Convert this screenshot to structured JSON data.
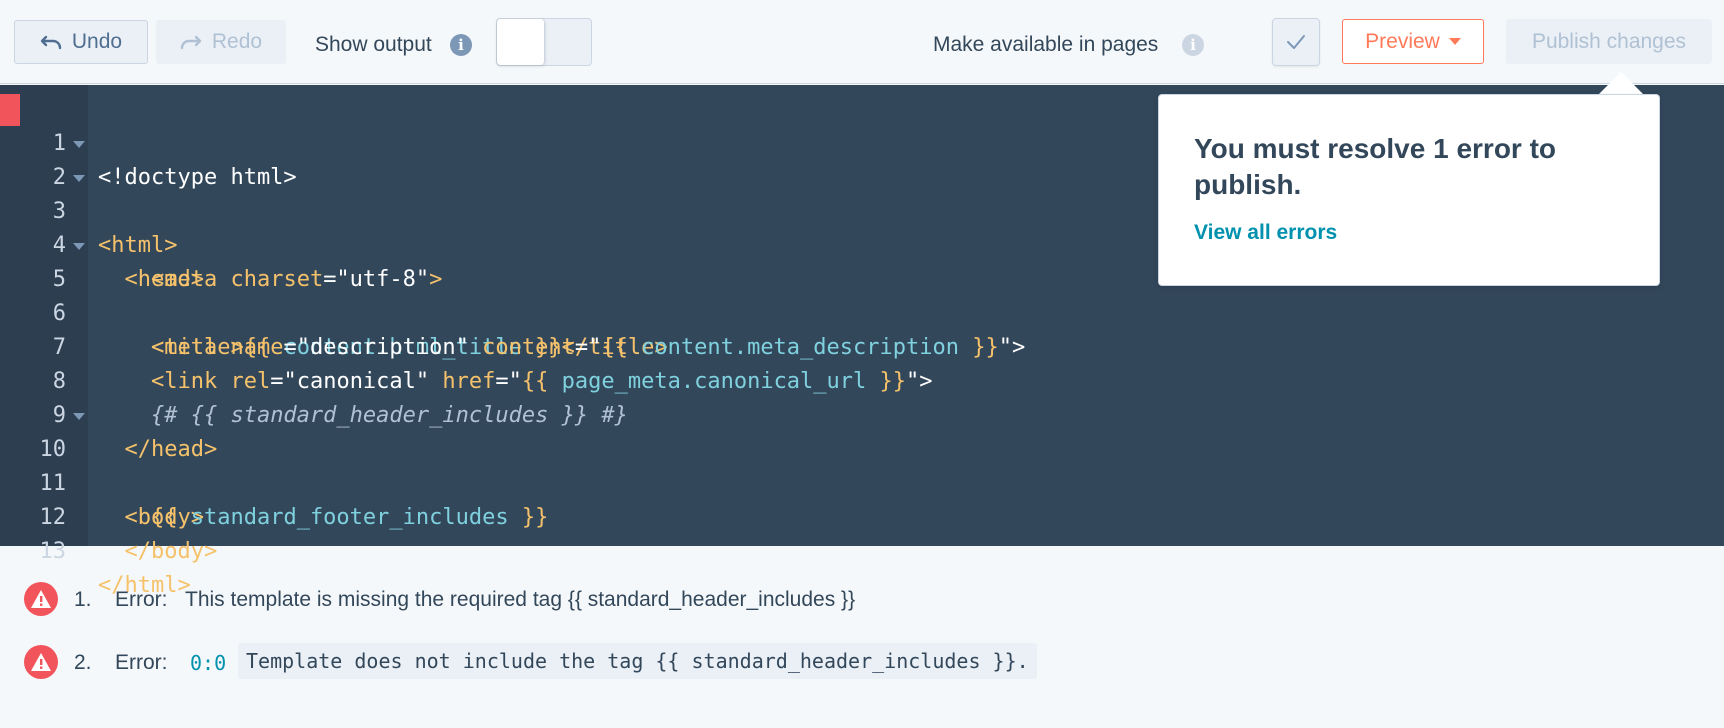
{
  "toolbar": {
    "undo_label": "Undo",
    "redo_label": "Redo",
    "show_output_label": "Show output",
    "make_available_label": "Make available in pages",
    "preview_label": "Preview",
    "publish_label": "Publish changes"
  },
  "editor": {
    "lines": [
      {
        "n": "1",
        "fold": false
      },
      {
        "n": "2",
        "fold": true
      },
      {
        "n": "3",
        "fold": true
      },
      {
        "n": "4",
        "fold": false
      },
      {
        "n": "5",
        "fold": true
      },
      {
        "n": "6",
        "fold": false
      },
      {
        "n": "7",
        "fold": false
      },
      {
        "n": "8",
        "fold": false
      },
      {
        "n": "9",
        "fold": false
      },
      {
        "n": "10",
        "fold": true
      },
      {
        "n": "11",
        "fold": false
      },
      {
        "n": "12",
        "fold": false
      },
      {
        "n": "13",
        "fold": false
      }
    ],
    "code": {
      "l1": "<!doctype html>",
      "l2": "<html>",
      "l3": "<head>",
      "l4_a": "<meta ",
      "l4_b": "charset",
      "l4_c": "=\"utf-8\"",
      "l4_d": ">",
      "l5_a": "<title>",
      "l5_b": "{{ ",
      "l5_c": "content.html_title",
      "l5_d": " }}",
      "l5_e": "</title>",
      "l6_a": "<meta ",
      "l6_b": "name",
      "l6_c": "=\"description\" ",
      "l6_d": "content",
      "l6_e": "=\"",
      "l6_f": "{{ ",
      "l6_g": "content.meta_description",
      "l6_h": " }}",
      "l6_i": "\">",
      "l7_a": "<link ",
      "l7_b": "rel",
      "l7_c": "=\"canonical\" ",
      "l7_d": "href",
      "l7_e": "=\"",
      "l7_f": "{{ ",
      "l7_g": "page_meta.canonical_url",
      "l7_h": " }}",
      "l7_i": "\">",
      "l8": "{# {{ standard_header_includes }} #}",
      "l9": "</head>",
      "l10": "<body>",
      "l11_a": "{{ ",
      "l11_b": "standard_footer_includes",
      "l11_c": " }}",
      "l12": "</body>",
      "l13": "</html>"
    }
  },
  "popover": {
    "title": "You must resolve 1 error to publish.",
    "link": "View all errors"
  },
  "errors": [
    {
      "num": "1.",
      "label": "Error:",
      "message": "This template is missing the required tag {{ standard_header_includes }}"
    },
    {
      "num": "2.",
      "label": "Error:",
      "location": "0:0",
      "code": "Template does not include the tag {{ standard_header_includes }}."
    }
  ],
  "colors": {
    "accent": "#ff7a59",
    "error": "#f2545b",
    "link": "#0091ae",
    "editor_bg": "#33475b"
  },
  "icons": [
    "undo-icon",
    "redo-icon",
    "info-icon",
    "check-icon",
    "caret-down-icon",
    "warning-icon"
  ]
}
